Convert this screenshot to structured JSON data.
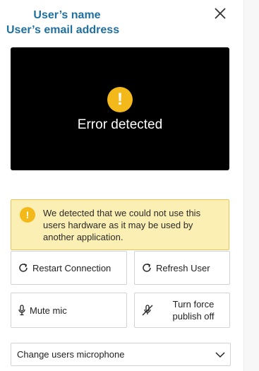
{
  "header": {
    "user_name": "User’s name",
    "user_email": "User’s email address",
    "close_icon": "close-icon"
  },
  "video": {
    "status_icon": "warning-icon",
    "status_icon_glyph": "!",
    "status_text": "Error detected"
  },
  "alert": {
    "icon": "warning-icon",
    "icon_glyph": "!",
    "message": "We detected that we could not use this users hardware as it may be used by another application."
  },
  "actions": {
    "restart_label": "Restart Connection",
    "refresh_label": "Refresh User",
    "mute_label": "Mute mic",
    "force_publish_line1": "Turn force",
    "force_publish_line2": "publish off",
    "restart_icon": "refresh-icon",
    "refresh_icon": "refresh-icon",
    "mute_icon": "microphone-icon",
    "force_icon": "microphone-off-icon"
  },
  "microphone_select": {
    "selected": "Change users microphone",
    "icon": "chevron-down-icon"
  },
  "colors": {
    "accent": "#1f6fa0",
    "warning": "#f3b81a",
    "alert_bg": "#fcefb4"
  }
}
